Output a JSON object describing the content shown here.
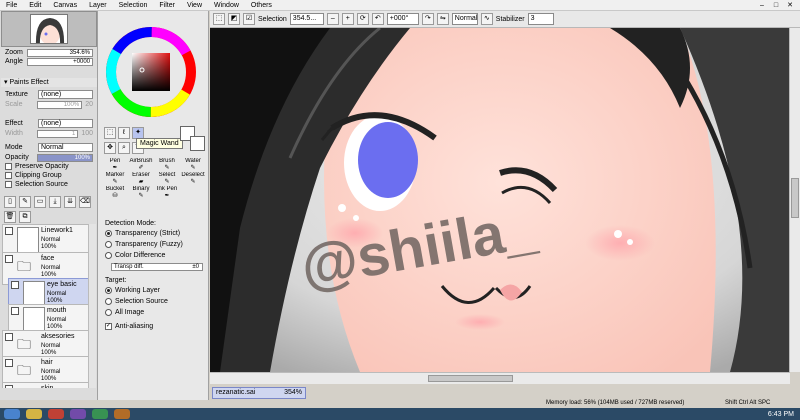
{
  "menu": {
    "items": [
      "File",
      "Edit",
      "Canvas",
      "Layer",
      "Selection",
      "Filter",
      "View",
      "Window",
      "Others"
    ]
  },
  "toolbar": {
    "selection_label": "Selection",
    "zoom": "354.5...",
    "angle": "+000°",
    "blend": "Normal",
    "stabilizer_label": "Stabilizer",
    "stabilizer_value": "3"
  },
  "navigator": {
    "zoom_label": "Zoom",
    "zoom_value": "354.6%",
    "angle_label": "Angle",
    "angle_value": "+0000"
  },
  "paints_effect": {
    "title": "Paints Effect",
    "texture_label": "Texture",
    "texture_value": "(none)",
    "scale_label": "Scale",
    "scale_value": "100%",
    "scale_num": "20",
    "effect_label": "Effect",
    "effect_value": "(none)",
    "width_label": "Width",
    "width_num": "1",
    "width_num2": "100"
  },
  "layer_props": {
    "mode_label": "Mode",
    "mode_value": "Normal",
    "opacity_label": "Opacity",
    "opacity_value": "100%",
    "preserve_opacity": "Preserve Opacity",
    "clipping_group": "Clipping Group",
    "selection_source": "Selection Source"
  },
  "layers": [
    {
      "name": "Linework1",
      "mode": "Normal",
      "opacity": "100%"
    },
    {
      "name": "face",
      "mode": "Normal",
      "opacity": "100%"
    },
    {
      "name": "eye basic",
      "mode": "Normal",
      "opacity": "100%"
    },
    {
      "name": "mouth",
      "mode": "Normal",
      "opacity": "100%"
    },
    {
      "name": "aksesories",
      "mode": "Normal",
      "opacity": "100%"
    },
    {
      "name": "hair",
      "mode": "Normal",
      "opacity": "100%"
    },
    {
      "name": "skin",
      "mode": "Normal",
      "opacity": "100%"
    }
  ],
  "tooltip": "Magic Wand",
  "tools": [
    "Pen",
    "AirBrush",
    "Brush",
    "Water",
    "Marker",
    "Eraser",
    "Select",
    "Deselect",
    "Bucket",
    "Binary",
    "Ink Pen"
  ],
  "detection": {
    "title": "Detection Mode:",
    "options": [
      "Transparency (Strict)",
      "Transparency (Fuzzy)",
      "Color Difference"
    ],
    "transp_label": "Transp diff.",
    "transp_value": "±0",
    "target_title": "Target:",
    "targets": [
      "Working Layer",
      "Selection Source",
      "All Image"
    ],
    "antialias": "Anti-aliasing"
  },
  "watermark": "@shiila_",
  "file_tab": {
    "name": "rezanatic.sai",
    "zoom": "354%"
  },
  "status": {
    "memory": "Memory load: 56% (104MB used / 727MB reserved)",
    "keys": "Shift Ctrl Alt SPC",
    "clock": "6:43 PM"
  },
  "colors": {
    "accent": "#7a87c8",
    "eye": "#6b6ef0",
    "skin": "#ffd2c8",
    "hair": "#2a2a2a"
  }
}
